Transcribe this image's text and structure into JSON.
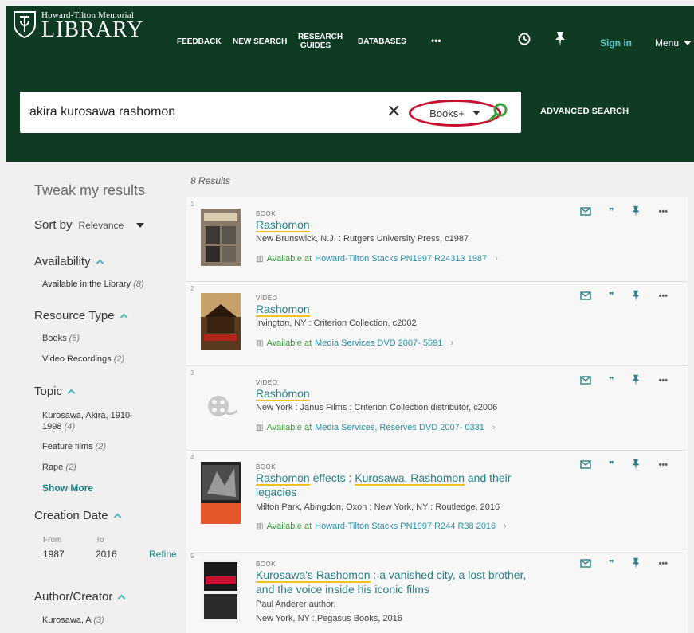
{
  "header": {
    "logo_small": "Howard-Tilton Memorial",
    "logo_big": "LIBRARY",
    "nav": [
      "FEEDBACK",
      "NEW SEARCH",
      "RESEARCH GUIDES",
      "DATABASES",
      "•••"
    ],
    "sign_in": "Sign in",
    "menu": "Menu"
  },
  "search": {
    "query": "akira kurosawa rashomon",
    "scope": "Books+",
    "advanced": "ADVANCED SEARCH"
  },
  "sidebar": {
    "tweak": "Tweak my results",
    "sort_label": "Sort by",
    "sort_value": "Relevance",
    "availability": {
      "title": "Availability",
      "items": [
        {
          "label": "Available in the Library",
          "count": "(8)"
        }
      ]
    },
    "resource_type": {
      "title": "Resource Type",
      "items": [
        {
          "label": "Books",
          "count": "(6)"
        },
        {
          "label": "Video Recordings",
          "count": "(2)"
        }
      ]
    },
    "topic": {
      "title": "Topic",
      "items": [
        {
          "label": "Kurosawa, Akira, 1910-",
          "label2": "1998",
          "count": "(4)"
        },
        {
          "label": "Feature films",
          "count": "(2)"
        },
        {
          "label": "Rape",
          "count": "(2)"
        }
      ],
      "show_more": "Show More"
    },
    "creation_date": {
      "title": "Creation Date",
      "from_label": "From",
      "to_label": "To",
      "from": "1987",
      "to": "2016",
      "refine": "Refine"
    },
    "author": {
      "title": "Author/Creator",
      "items": [
        {
          "label": "Kurosawa, A",
          "count": "(3)"
        }
      ]
    }
  },
  "results": {
    "count": "8 Results",
    "items": [
      {
        "num": "1",
        "type": "BOOK",
        "title_hl": "Rashomon",
        "title_rest": "",
        "sub": "New Brunswick, N.J. : Rutgers University Press, c1987",
        "avail_text": "Available at",
        "loc": "Howard-Tilton Stacks PN1997.R24313 1987"
      },
      {
        "num": "2",
        "type": "VIDEO",
        "title_hl": "Rashomon",
        "title_rest": "",
        "sub": "Irvington, NY : Criterion Collection, c2002",
        "avail_text": "Available at",
        "loc": "Media Services DVD 2007- 5691"
      },
      {
        "num": "3",
        "type": "VIDEO",
        "title_hl": "Rashōmon",
        "title_rest": "",
        "sub": "New York : Janus Films : Criterion Collection distributor, c2006",
        "avail_text": "Available at",
        "loc": "Media Services, Reserves DVD 2007- 0331"
      },
      {
        "num": "4",
        "type": "BOOK",
        "title_hl": "Rashomon",
        "title_mid": " effects : ",
        "title_hl2": "Kurosawa, Rashomon",
        "title_rest": " and their legacies",
        "sub": "Milton Park, Abingdon, Oxon ; New York, NY : Routledge, 2016",
        "avail_text": "Available at",
        "loc": "Howard-Tilton Stacks PN1997.R244 R38 2016"
      },
      {
        "num": "5",
        "type": "BOOK",
        "title_hl": "Kurosawa's Rashomon",
        "title_rest": " : a vanished city, a lost brother, and the voice inside his iconic films",
        "sub": "Paul Anderer author.",
        "sub2": "New York, NY : Pegasus Books, 2016"
      }
    ]
  },
  "colors": {
    "header_bg": "#0f3b23",
    "accent": "#2a7f88",
    "highlight": "#f2c21b",
    "circle": "#c8102e"
  }
}
